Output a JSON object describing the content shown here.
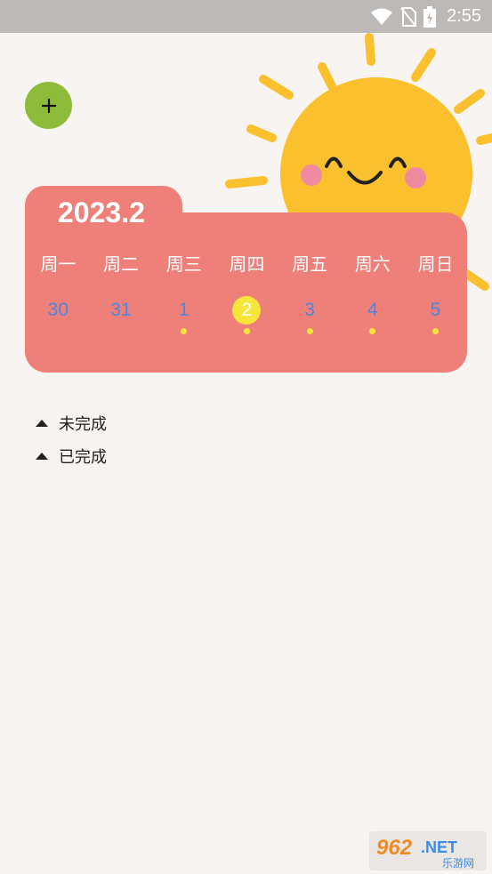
{
  "status_bar": {
    "time": "2:55",
    "icons": [
      "wifi-icon",
      "no-sim-icon",
      "battery-charging-icon"
    ]
  },
  "add_button": {
    "label": "+"
  },
  "calendar": {
    "title": "2023.2",
    "weekdays": [
      "周一",
      "周二",
      "周三",
      "周四",
      "周五",
      "周六",
      "周日"
    ],
    "dates": [
      {
        "day": "30",
        "has_task": false,
        "today": false
      },
      {
        "day": "31",
        "has_task": false,
        "today": false
      },
      {
        "day": "1",
        "has_task": true,
        "today": false
      },
      {
        "day": "2",
        "has_task": true,
        "today": true
      },
      {
        "day": "3",
        "has_task": true,
        "today": false
      },
      {
        "day": "4",
        "has_task": true,
        "today": false
      },
      {
        "day": "5",
        "has_task": true,
        "today": false
      }
    ]
  },
  "sections": {
    "incomplete": "未完成",
    "complete": "已完成"
  },
  "watermark": {
    "text": "962.NET",
    "subtext": "乐游网"
  },
  "colors": {
    "calendar_bg": "#ef8079",
    "accent_yellow": "#f7e53a",
    "add_button": "#8dbb3a",
    "date_text": "#4a86e0",
    "sun": "#fbc02d"
  }
}
